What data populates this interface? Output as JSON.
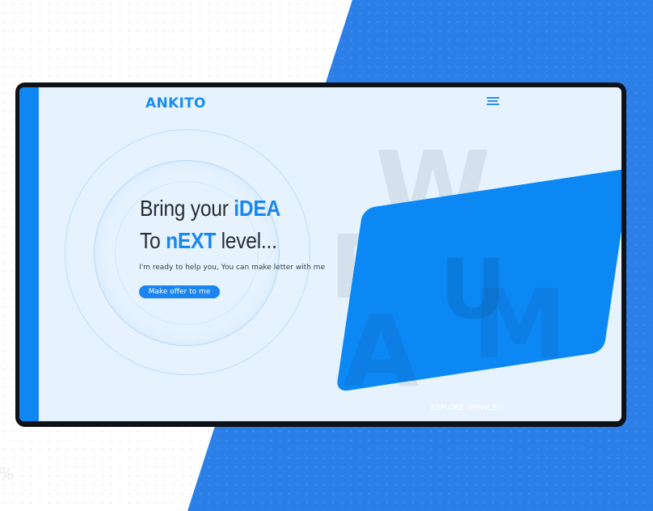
{
  "header": {
    "logo": "ANKITO",
    "menu_icon": "hamburger-menu-icon"
  },
  "hero": {
    "line1_prefix": "Bring your ",
    "line1_highlight": "iDEA",
    "line2_prefix": "To ",
    "line2_highlight": "nEXT",
    "line2_suffix": " level...",
    "subtext": "I'm ready to help you, You can make letter with me",
    "cta_label": "Make offer to me"
  },
  "decor": {
    "letters": [
      "W",
      "D",
      "U",
      "A",
      "M"
    ]
  },
  "footer": {
    "explore_label": "EXPLORE SERVICES"
  },
  "colors": {
    "accent": "#1a86ee",
    "accent_dark": "#0b88f4",
    "background_blue": "#2c7fe6",
    "screen_bg": "#e6f3fe",
    "frame": "#0e1116"
  }
}
